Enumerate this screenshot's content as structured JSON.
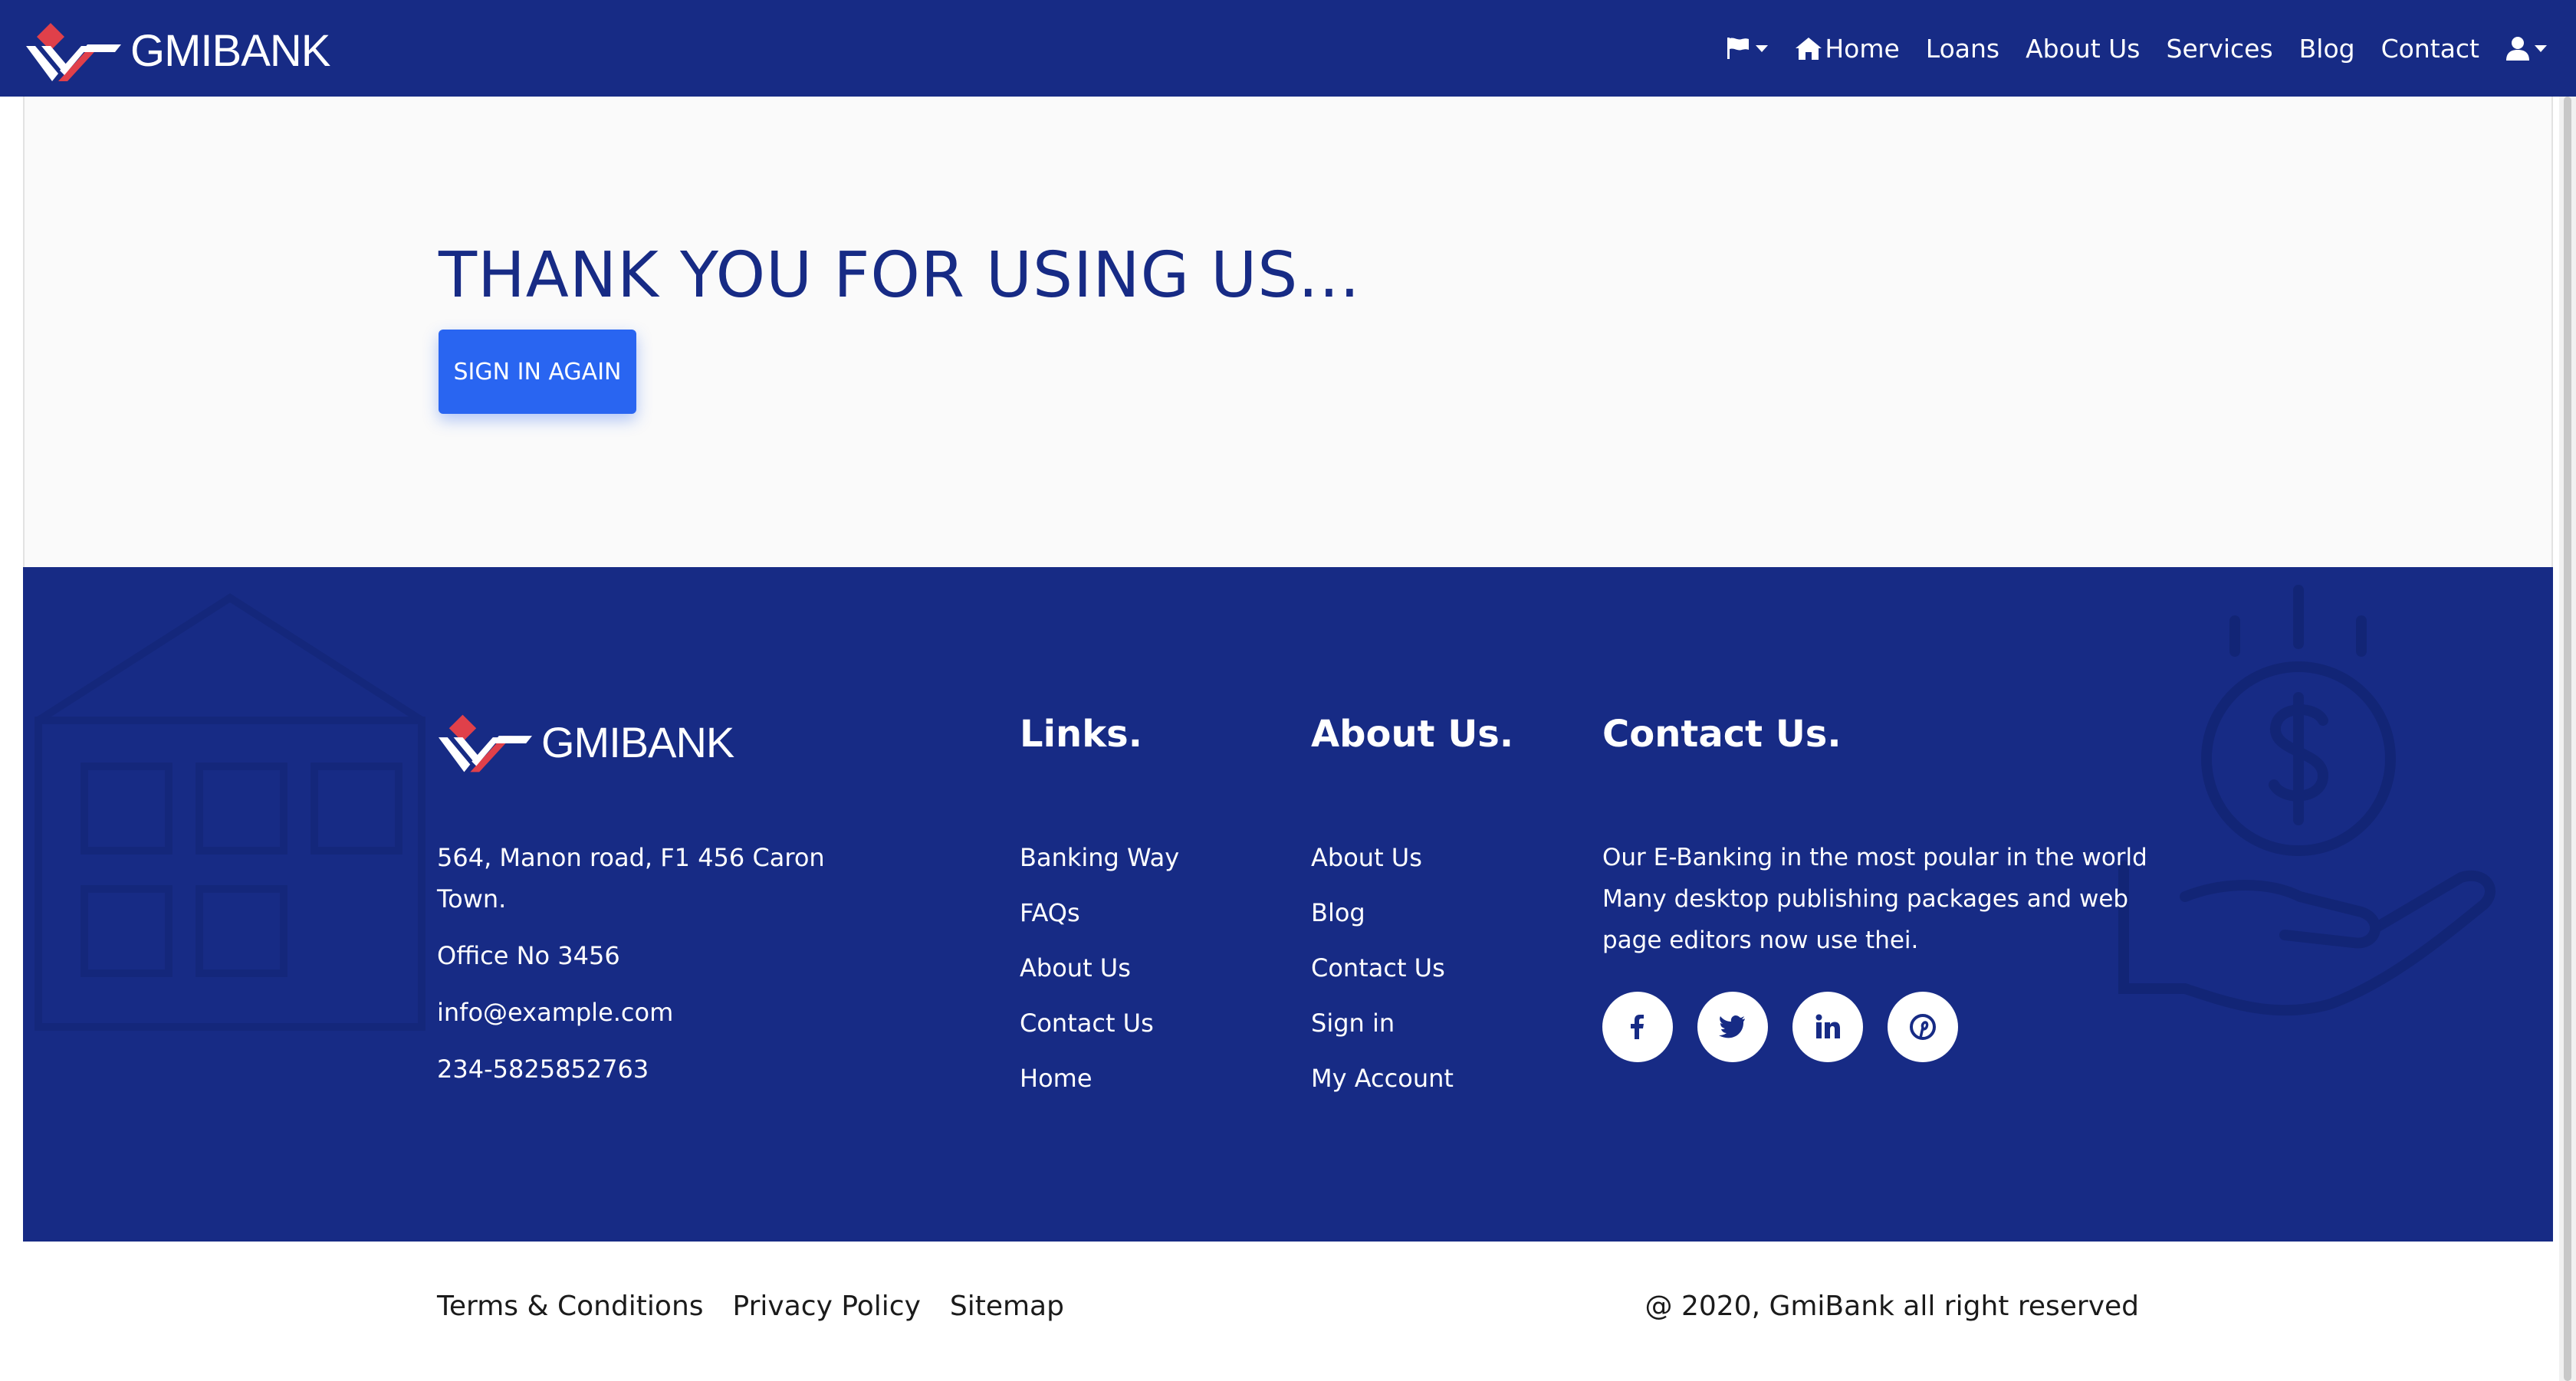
{
  "brand": {
    "name": "GMIBANK"
  },
  "nav": {
    "items": [
      "Home",
      "Loans",
      "About Us",
      "Services",
      "Blog",
      "Contact"
    ]
  },
  "hero": {
    "title": "THANK YOU FOR USING US...",
    "button": "SIGN IN AGAIN"
  },
  "footer": {
    "brand": "GMIBANK",
    "address_line1": "564, Manon road, F1 456 Caron",
    "address_line2": "Town.",
    "office": "Office No 3456",
    "email": "info@example.com",
    "phone": "234-5825852763",
    "links": {
      "title": "Links.",
      "items": [
        "Banking Way",
        "FAQs",
        "About Us",
        "Contact Us",
        "Home"
      ]
    },
    "about": {
      "title": "About Us.",
      "items": [
        "About Us",
        "Blog",
        "Contact Us",
        "Sign in",
        "My Account"
      ]
    },
    "contact": {
      "title": "Contact Us.",
      "text": "Our E-Banking in the most poular in the world Many desktop publishing packages and web page editors now use thei."
    },
    "socials": [
      {
        "icon": "facebook-icon",
        "glyph": "f"
      },
      {
        "icon": "twitter-icon",
        "glyph": "🐦"
      },
      {
        "icon": "linkedin-icon",
        "glyph": "in"
      },
      {
        "icon": "pinterest-icon",
        "glyph": "P"
      }
    ]
  },
  "bottom": {
    "links": [
      "Terms & Conditions",
      "Privacy Policy",
      "Sitemap"
    ],
    "copyright": "@ 2020, GmiBank all right reserved"
  },
  "colors": {
    "primary": "#172b85",
    "accent": "#2965f1",
    "logo_red": "#e0404a"
  }
}
